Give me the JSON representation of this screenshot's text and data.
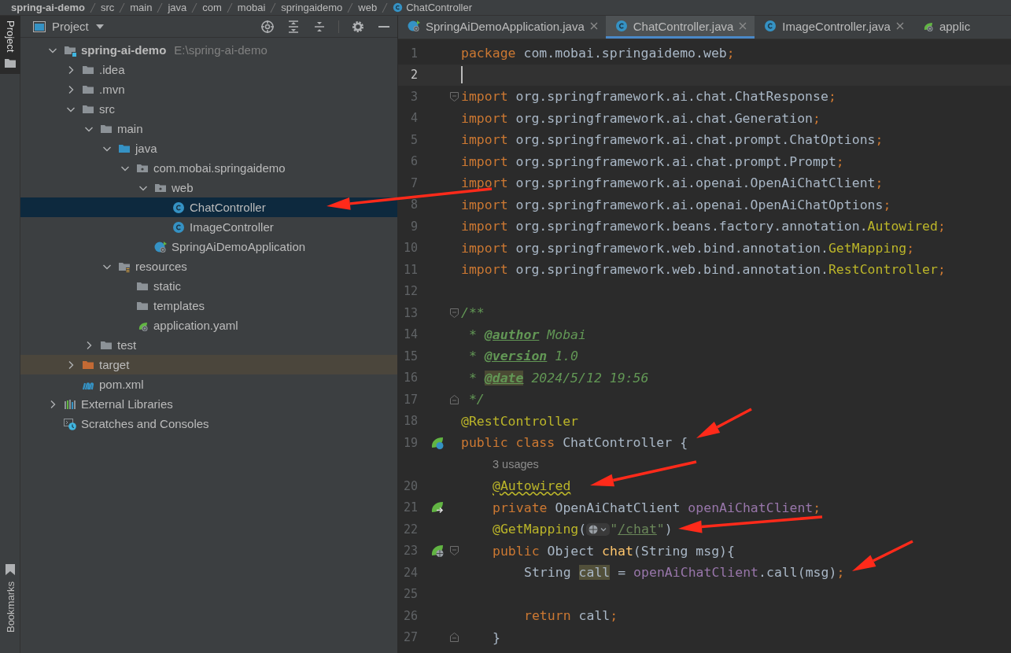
{
  "breadcrumbs": [
    {
      "label": "spring-ai-demo",
      "kind": "module"
    },
    {
      "label": "src",
      "kind": "folder"
    },
    {
      "label": "main",
      "kind": "folder"
    },
    {
      "label": "java",
      "kind": "folder"
    },
    {
      "label": "com",
      "kind": "folder"
    },
    {
      "label": "mobai",
      "kind": "folder"
    },
    {
      "label": "springaidemo",
      "kind": "folder"
    },
    {
      "label": "web",
      "kind": "folder"
    },
    {
      "label": "ChatController",
      "kind": "class"
    }
  ],
  "tool_stripe": {
    "top": [
      {
        "label": "Project",
        "selected": true
      }
    ],
    "bottom": [
      {
        "label": "Bookmarks",
        "selected": false
      }
    ]
  },
  "project_panel": {
    "title": "Project",
    "tree": [
      {
        "name": "spring-ai-demo",
        "hint": "E:\\spring-ai-demo",
        "kind": "module",
        "expanded": true,
        "selected": false,
        "children": [
          {
            "name": ".idea",
            "kind": "folder",
            "expanded": false,
            "selected": false
          },
          {
            "name": ".mvn",
            "kind": "folder",
            "expanded": false,
            "selected": false
          },
          {
            "name": "src",
            "kind": "folder",
            "expanded": true,
            "selected": false,
            "children": [
              {
                "name": "main",
                "kind": "folder",
                "expanded": true,
                "selected": false,
                "children": [
                  {
                    "name": "java",
                    "kind": "source-folder",
                    "expanded": true,
                    "selected": false,
                    "children": [
                      {
                        "name": "com.mobai.springaidemo",
                        "kind": "package",
                        "expanded": true,
                        "selected": false,
                        "children": [
                          {
                            "name": "web",
                            "kind": "package",
                            "expanded": true,
                            "selected": false,
                            "children": [
                              {
                                "name": "ChatController",
                                "kind": "class",
                                "selected": true
                              },
                              {
                                "name": "ImageController",
                                "kind": "class",
                                "selected": false
                              }
                            ]
                          },
                          {
                            "name": "SpringAiDemoApplication",
                            "kind": "spring-class",
                            "selected": false
                          }
                        ]
                      }
                    ]
                  },
                  {
                    "name": "resources",
                    "kind": "resources-folder",
                    "expanded": true,
                    "selected": false,
                    "children": [
                      {
                        "name": "static",
                        "kind": "folder",
                        "selected": false
                      },
                      {
                        "name": "templates",
                        "kind": "folder",
                        "selected": false
                      },
                      {
                        "name": "application.yaml",
                        "kind": "spring-config",
                        "selected": false
                      }
                    ]
                  }
                ]
              },
              {
                "name": "test",
                "kind": "folder",
                "expanded": false,
                "selected": false
              }
            ]
          },
          {
            "name": "target",
            "kind": "excluded-folder",
            "expanded": false,
            "selected": false
          },
          {
            "name": "pom.xml",
            "kind": "maven",
            "selected": false
          }
        ]
      },
      {
        "name": "External Libraries",
        "kind": "libraries",
        "expanded": false,
        "selected": false
      },
      {
        "name": "Scratches and Consoles",
        "kind": "scratches",
        "selected": false
      }
    ]
  },
  "editor": {
    "tabs": [
      {
        "label": "SpringAiDemoApplication.java",
        "kind": "spring-class",
        "selected": false,
        "closable": true
      },
      {
        "label": "ChatController.java",
        "kind": "class",
        "selected": true,
        "closable": true
      },
      {
        "label": "ImageController.java",
        "kind": "class",
        "selected": false,
        "closable": true
      },
      {
        "label": "applic",
        "kind": "spring-config",
        "selected": false,
        "closable": false
      }
    ],
    "lines": [
      {
        "kind": "code",
        "number": "1",
        "current": false,
        "tokens": [
          {
            "text": "package",
            "kind": "kw"
          },
          {
            "text": " com.mobai.springaidemo.web",
            "kind": "plain"
          },
          {
            "text": ";",
            "kind": "kw"
          }
        ]
      },
      {
        "kind": "code",
        "number": "2",
        "current": true
      },
      {
        "kind": "code",
        "number": "3",
        "current": false,
        "fold_marker": {
          "kind": "start"
        },
        "tokens": [
          {
            "text": "import",
            "kind": "kw"
          },
          {
            "text": " org.springframework.ai.chat.ChatResponse",
            "kind": "plain"
          },
          {
            "text": ";",
            "kind": "kw"
          }
        ]
      },
      {
        "kind": "code",
        "number": "4",
        "current": false,
        "tokens": [
          {
            "text": "import",
            "kind": "kw"
          },
          {
            "text": " org.springframework.ai.chat.Generation",
            "kind": "plain"
          },
          {
            "text": ";",
            "kind": "kw"
          }
        ]
      },
      {
        "kind": "code",
        "number": "5",
        "current": false,
        "tokens": [
          {
            "text": "import",
            "kind": "kw"
          },
          {
            "text": " org.springframework.ai.chat.prompt.ChatOptions",
            "kind": "plain"
          },
          {
            "text": ";",
            "kind": "kw"
          }
        ]
      },
      {
        "kind": "code",
        "number": "6",
        "current": false,
        "tokens": [
          {
            "text": "import",
            "kind": "kw"
          },
          {
            "text": " org.springframework.ai.chat.prompt.Prompt",
            "kind": "plain"
          },
          {
            "text": ";",
            "kind": "kw"
          }
        ]
      },
      {
        "kind": "code",
        "number": "7",
        "current": false,
        "tokens": [
          {
            "text": "import",
            "kind": "kw"
          },
          {
            "text": " org.springframework.ai.openai.OpenAiChatClient",
            "kind": "plain"
          },
          {
            "text": ";",
            "kind": "kw"
          }
        ]
      },
      {
        "kind": "code",
        "number": "8",
        "current": false,
        "tokens": [
          {
            "text": "import",
            "kind": "kw"
          },
          {
            "text": " org.springframework.ai.openai.OpenAiChatOptions",
            "kind": "plain"
          },
          {
            "text": ";",
            "kind": "kw"
          }
        ]
      },
      {
        "kind": "code",
        "number": "9",
        "current": false,
        "tokens": [
          {
            "text": "import",
            "kind": "kw"
          },
          {
            "text": " org.springframework.beans.factory.annotation.",
            "kind": "plain"
          },
          {
            "text": "Autowired",
            "kind": "ann"
          },
          {
            "text": ";",
            "kind": "kw"
          }
        ]
      },
      {
        "kind": "code",
        "number": "10",
        "current": false,
        "tokens": [
          {
            "text": "import",
            "kind": "kw"
          },
          {
            "text": " org.springframework.web.bind.annotation.",
            "kind": "plain"
          },
          {
            "text": "GetMapping",
            "kind": "ann"
          },
          {
            "text": ";",
            "kind": "kw"
          }
        ]
      },
      {
        "kind": "code",
        "number": "11",
        "current": false,
        "tokens": [
          {
            "text": "import",
            "kind": "kw"
          },
          {
            "text": " org.springframework.web.bind.annotation.",
            "kind": "plain"
          },
          {
            "text": "RestController",
            "kind": "ann"
          },
          {
            "text": ";",
            "kind": "kw"
          }
        ]
      },
      {
        "kind": "code",
        "number": "12",
        "current": false
      },
      {
        "kind": "code",
        "number": "13",
        "current": false,
        "fold_marker": {
          "kind": "start"
        },
        "tokens": [
          {
            "text": "/**",
            "kind": "doc"
          }
        ]
      },
      {
        "kind": "code",
        "number": "14",
        "current": false,
        "tokens": [
          {
            "text": " * ",
            "kind": "doc"
          },
          {
            "text": "@author",
            "kind": "doctag"
          },
          {
            "text": " Mobai",
            "kind": "doc"
          }
        ]
      },
      {
        "kind": "code",
        "number": "15",
        "current": false,
        "tokens": [
          {
            "text": " * ",
            "kind": "doc"
          },
          {
            "text": "@version",
            "kind": "doctag"
          },
          {
            "text": " 1.0",
            "kind": "doc"
          }
        ]
      },
      {
        "kind": "code",
        "number": "16",
        "current": false,
        "tokens": [
          {
            "text": " * ",
            "kind": "doc"
          },
          {
            "text": "@date",
            "kind": "doctag-hl"
          },
          {
            "text": " 2024/5/12 19:56",
            "kind": "doc"
          }
        ]
      },
      {
        "kind": "code",
        "number": "17",
        "current": false,
        "fold_marker": {
          "kind": "end"
        },
        "tokens": [
          {
            "text": " */",
            "kind": "doc"
          }
        ]
      },
      {
        "kind": "code",
        "number": "18",
        "current": false,
        "tokens": [
          {
            "text": "@RestController",
            "kind": "ann"
          }
        ]
      },
      {
        "kind": "code",
        "number": "19",
        "current": false,
        "gutter_icon": {
          "kind": "bean"
        },
        "tokens": [
          {
            "text": "public class",
            "kind": "kw"
          },
          {
            "text": " ChatController {",
            "kind": "plain"
          }
        ]
      },
      {
        "kind": "inlay",
        "text": "3 usages"
      },
      {
        "kind": "member",
        "number": "20",
        "current": false,
        "tokens": [
          {
            "text": "@Autowired",
            "kind": "ann-warn"
          }
        ]
      },
      {
        "kind": "member",
        "number": "21",
        "current": false,
        "gutter_icon": {
          "kind": "inject"
        },
        "tokens": [
          {
            "text": "private",
            "kind": "kw"
          },
          {
            "text": " OpenAiChatClient ",
            "kind": "plain"
          },
          {
            "text": "openAiChatClient",
            "kind": "field"
          },
          {
            "text": ";",
            "kind": "kw"
          }
        ]
      },
      {
        "kind": "member",
        "number": "22",
        "current": false,
        "tokens": [
          {
            "text": "@GetMapping",
            "kind": "ann"
          },
          {
            "text": "(",
            "kind": "plain"
          },
          {
            "kind": "web-inlay"
          },
          {
            "text": "\"",
            "kind": "str"
          },
          {
            "text": "/chat",
            "kind": "str-link"
          },
          {
            "text": "\"",
            "kind": "str"
          },
          {
            "text": ")",
            "kind": "plain"
          }
        ]
      },
      {
        "kind": "member",
        "number": "23",
        "current": false,
        "gutter_icon": {
          "kind": "web"
        },
        "fold_marker": {
          "kind": "start"
        },
        "tokens": [
          {
            "text": "public",
            "kind": "kw"
          },
          {
            "text": " Object ",
            "kind": "plain"
          },
          {
            "text": "chat",
            "kind": "method"
          },
          {
            "text": "(String msg){",
            "kind": "plain"
          }
        ]
      },
      {
        "kind": "body",
        "number": "24",
        "current": false,
        "tokens": [
          {
            "text": "String ",
            "kind": "plain"
          },
          {
            "text": "call",
            "kind": "hl"
          },
          {
            "text": " = ",
            "kind": "plain"
          },
          {
            "text": "openAiChatClient",
            "kind": "field"
          },
          {
            "text": ".call(msg)",
            "kind": "plain"
          },
          {
            "text": ";",
            "kind": "kw"
          }
        ]
      },
      {
        "kind": "body",
        "number": "25",
        "current": false
      },
      {
        "kind": "body",
        "number": "26",
        "current": false,
        "tokens": [
          {
            "text": "return",
            "kind": "kw"
          },
          {
            "text": " call",
            "kind": "plain"
          },
          {
            "text": ";",
            "kind": "kw"
          }
        ]
      },
      {
        "kind": "member",
        "number": "27",
        "current": false,
        "fold_marker": {
          "kind": "end"
        },
        "tokens": [
          {
            "text": "}",
            "kind": "plain"
          }
        ]
      }
    ]
  }
}
